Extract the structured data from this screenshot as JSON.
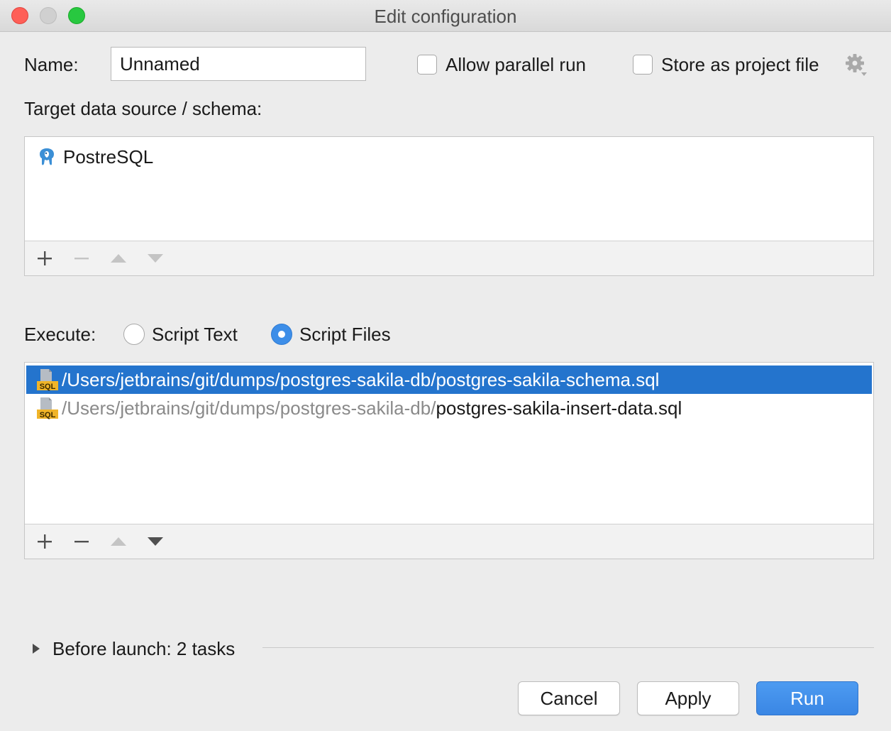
{
  "window": {
    "title": "Edit configuration"
  },
  "form": {
    "name_label": "Name:",
    "name_value": "Unnamed",
    "allow_parallel_label": "Allow parallel run",
    "store_project_label": "Store as project file",
    "target_label": "Target data source / schema:",
    "execute_label": "Execute:"
  },
  "datasources": {
    "items": [
      {
        "label": "PostreSQL",
        "icon": "postgresql-elephant-icon"
      }
    ]
  },
  "execute": {
    "options": [
      {
        "label": "Script Text",
        "selected": false
      },
      {
        "label": "Script Files",
        "selected": true
      }
    ]
  },
  "files": [
    {
      "dir": "/Users/jetbrains/git/dumps/postgres-sakila-db/",
      "name": "postgres-sakila-schema.sql",
      "selected": true
    },
    {
      "dir": "/Users/jetbrains/git/dumps/postgres-sakila-db/",
      "name": "postgres-sakila-insert-data.sql",
      "selected": false
    }
  ],
  "before_launch": {
    "label": "Before launch: 2 tasks"
  },
  "buttons": {
    "cancel": "Cancel",
    "apply": "Apply",
    "run": "Run"
  },
  "colors": {
    "accent": "#3d8ee8",
    "selection": "#2474cd",
    "sql_badge": "#f0b429"
  }
}
